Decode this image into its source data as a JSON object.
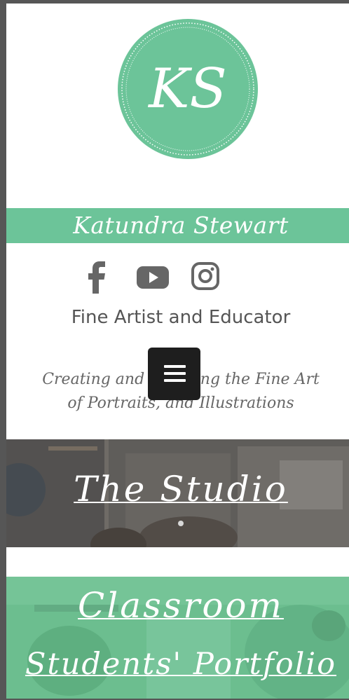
{
  "logo": {
    "monogram": "KS",
    "icon": "ks-monogram-logo"
  },
  "site": {
    "name": "Katundra Stewart"
  },
  "social": [
    {
      "label": "Facebook",
      "icon": "facebook-icon"
    },
    {
      "label": "YouTube",
      "icon": "youtube-icon"
    },
    {
      "label": "Instagram",
      "icon": "instagram-icon"
    }
  ],
  "tagline": "Fine Artist and Educator",
  "subtitle": {
    "line1": "Creating and Teaching the Fine Art",
    "line2": "of Portraits, and Illustrations"
  },
  "menu": {
    "icon": "hamburger-menu-icon"
  },
  "banners": {
    "studio": "The Studio",
    "classroom": "Classroom",
    "portfolio": "Students' Portfolio"
  },
  "colors": {
    "accent": "#6cc499",
    "menu_button": "#1e1e1e",
    "text_gray": "#555555"
  }
}
